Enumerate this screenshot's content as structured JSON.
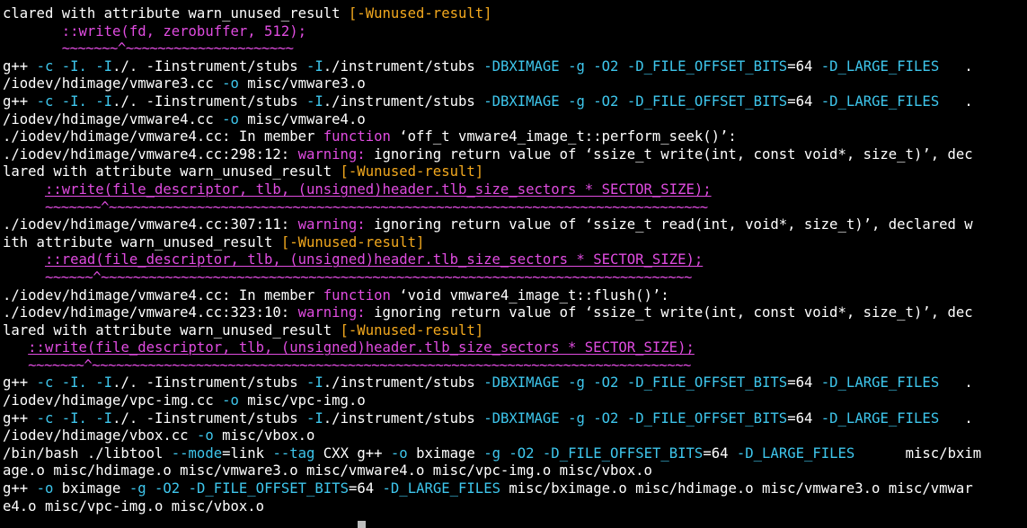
{
  "colors": {
    "background": "#000000",
    "text": "#ffffff",
    "option_flag": "#3ec6ec",
    "warning_keyword": "#e04ce0",
    "warning_option": "#f2a81e",
    "caret_marker": "#e04ce0",
    "cursor": "#bdbdbd"
  },
  "terminal": {
    "lines": [
      [
        {
          "c": "w",
          "t": "clared with attribute warn_unused_result "
        },
        {
          "c": "y",
          "t": "[-Wunused-result]"
        }
      ],
      [
        {
          "c": "w",
          "t": "       "
        },
        {
          "c": "m",
          "t": "::write(fd, zerobuffer, 512);"
        }
      ],
      [
        {
          "c": "w",
          "t": "       "
        },
        {
          "c": "sq",
          "t": "~~~~~~~^~~~~~~~~~~~~~~~~~~~~~"
        }
      ],
      [
        {
          "c": "w",
          "t": "g++ "
        },
        {
          "c": "c",
          "t": "-c"
        },
        {
          "c": "w",
          "t": " "
        },
        {
          "c": "c",
          "t": "-I."
        },
        {
          "c": "w",
          "t": " "
        },
        {
          "c": "c",
          "t": "-I"
        },
        {
          "c": "w",
          "t": "./. -Iinstrument/stubs "
        },
        {
          "c": "c",
          "t": "-I"
        },
        {
          "c": "w",
          "t": "./instrument/stubs "
        },
        {
          "c": "c",
          "t": "-DBXIMAGE"
        },
        {
          "c": "w",
          "t": " "
        },
        {
          "c": "c",
          "t": "-g"
        },
        {
          "c": "w",
          "t": " "
        },
        {
          "c": "c",
          "t": "-O2"
        },
        {
          "c": "w",
          "t": " "
        },
        {
          "c": "c",
          "t": "-D_FILE_OFFSET_BITS"
        },
        {
          "c": "w",
          "t": "=64 "
        },
        {
          "c": "c",
          "t": "-D_LARGE_FILES"
        },
        {
          "c": "w",
          "t": "   ."
        }
      ],
      [
        {
          "c": "w",
          "t": "/iodev/hdimage/vmware3.cc "
        },
        {
          "c": "c",
          "t": "-o"
        },
        {
          "c": "w",
          "t": " misc/vmware3.o"
        }
      ],
      [
        {
          "c": "w",
          "t": "g++ "
        },
        {
          "c": "c",
          "t": "-c"
        },
        {
          "c": "w",
          "t": " "
        },
        {
          "c": "c",
          "t": "-I."
        },
        {
          "c": "w",
          "t": " "
        },
        {
          "c": "c",
          "t": "-I"
        },
        {
          "c": "w",
          "t": "./. -Iinstrument/stubs "
        },
        {
          "c": "c",
          "t": "-I"
        },
        {
          "c": "w",
          "t": "./instrument/stubs "
        },
        {
          "c": "c",
          "t": "-DBXIMAGE"
        },
        {
          "c": "w",
          "t": " "
        },
        {
          "c": "c",
          "t": "-g"
        },
        {
          "c": "w",
          "t": " "
        },
        {
          "c": "c",
          "t": "-O2"
        },
        {
          "c": "w",
          "t": " "
        },
        {
          "c": "c",
          "t": "-D_FILE_OFFSET_BITS"
        },
        {
          "c": "w",
          "t": "=64 "
        },
        {
          "c": "c",
          "t": "-D_LARGE_FILES"
        },
        {
          "c": "w",
          "t": "   ."
        }
      ],
      [
        {
          "c": "w",
          "t": "/iodev/hdimage/vmware4.cc "
        },
        {
          "c": "c",
          "t": "-o"
        },
        {
          "c": "w",
          "t": " misc/vmware4.o"
        }
      ],
      [
        {
          "c": "w",
          "t": "./iodev/hdimage/vmware4.cc: In member "
        },
        {
          "c": "m",
          "t": "function"
        },
        {
          "c": "w",
          "t": " ‘off_t vmware4_image_t::perform_seek()’:"
        }
      ],
      [
        {
          "c": "w",
          "t": "./iodev/hdimage/vmware4.cc:298:12: "
        },
        {
          "c": "m",
          "t": "warning:"
        },
        {
          "c": "w",
          "t": " ignoring return value of ‘ssize_t write(int, const void*, size_t)’, dec"
        }
      ],
      [
        {
          "c": "w",
          "t": "lared with attribute warn_unused_result "
        },
        {
          "c": "y",
          "t": "[-Wunused-result]"
        }
      ],
      [
        {
          "c": "w",
          "t": "     "
        },
        {
          "c": "m-u",
          "t": "::write(file_descriptor, tlb, (unsigned)header.tlb_size_sectors * SECTOR_SIZE);"
        }
      ],
      [
        {
          "c": "w",
          "t": "     "
        },
        {
          "c": "sq",
          "t": "~~~~~~~^~~~~~~~~~~~~~~~~~~~~~~~~~~~~~~~~~~~~~~~~~~~~~~~~~~~~~~~~~~~~~~~~~~~~~~~~~~~"
        }
      ],
      [
        {
          "c": "w",
          "t": "./iodev/hdimage/vmware4.cc:307:11: "
        },
        {
          "c": "m",
          "t": "warning:"
        },
        {
          "c": "w",
          "t": " ignoring return value of ‘ssize_t read(int, void*, size_t)’, declared w"
        }
      ],
      [
        {
          "c": "w",
          "t": "ith attribute warn_unused_result "
        },
        {
          "c": "y",
          "t": "[-Wunused-result]"
        }
      ],
      [
        {
          "c": "w",
          "t": "     "
        },
        {
          "c": "m-u",
          "t": "::read(file_descriptor, tlb, (unsigned)header.tlb_size_sectors * SECTOR_SIZE);"
        }
      ],
      [
        {
          "c": "w",
          "t": "     "
        },
        {
          "c": "sq",
          "t": "~~~~~~^~~~~~~~~~~~~~~~~~~~~~~~~~~~~~~~~~~~~~~~~~~~~~~~~~~~~~~~~~~~~~~~~~~~~~~~~~~"
        }
      ],
      [
        {
          "c": "w",
          "t": "./iodev/hdimage/vmware4.cc: In member "
        },
        {
          "c": "m",
          "t": "function"
        },
        {
          "c": "w",
          "t": " ‘void vmware4_image_t::flush()’:"
        }
      ],
      [
        {
          "c": "w",
          "t": "./iodev/hdimage/vmware4.cc:323:10: "
        },
        {
          "c": "m",
          "t": "warning:"
        },
        {
          "c": "w",
          "t": " ignoring return value of ‘ssize_t write(int, const void*, size_t)’, dec"
        }
      ],
      [
        {
          "c": "w",
          "t": "lared with attribute warn_unused_result "
        },
        {
          "c": "y",
          "t": "[-Wunused-result]"
        }
      ],
      [
        {
          "c": "w",
          "t": "   "
        },
        {
          "c": "m-u",
          "t": "::write(file_descriptor, tlb, (unsigned)header.tlb_size_sectors * SECTOR_SIZE);"
        }
      ],
      [
        {
          "c": "w",
          "t": "   "
        },
        {
          "c": "sq",
          "t": "~~~~~~~^~~~~~~~~~~~~~~~~~~~~~~~~~~~~~~~~~~~~~~~~~~~~~~~~~~~~~~~~~~~~~~~~~~~~~~~~~~~"
        }
      ],
      [
        {
          "c": "w",
          "t": "g++ "
        },
        {
          "c": "c",
          "t": "-c"
        },
        {
          "c": "w",
          "t": " "
        },
        {
          "c": "c",
          "t": "-I."
        },
        {
          "c": "w",
          "t": " "
        },
        {
          "c": "c",
          "t": "-I"
        },
        {
          "c": "w",
          "t": "./. -Iinstrument/stubs "
        },
        {
          "c": "c",
          "t": "-I"
        },
        {
          "c": "w",
          "t": "./instrument/stubs "
        },
        {
          "c": "c",
          "t": "-DBXIMAGE"
        },
        {
          "c": "w",
          "t": " "
        },
        {
          "c": "c",
          "t": "-g"
        },
        {
          "c": "w",
          "t": " "
        },
        {
          "c": "c",
          "t": "-O2"
        },
        {
          "c": "w",
          "t": " "
        },
        {
          "c": "c",
          "t": "-D_FILE_OFFSET_BITS"
        },
        {
          "c": "w",
          "t": "=64 "
        },
        {
          "c": "c",
          "t": "-D_LARGE_FILES"
        },
        {
          "c": "w",
          "t": "   ."
        }
      ],
      [
        {
          "c": "w",
          "t": "/iodev/hdimage/vpc-img.cc "
        },
        {
          "c": "c",
          "t": "-o"
        },
        {
          "c": "w",
          "t": " misc/vpc-img.o"
        }
      ],
      [
        {
          "c": "w",
          "t": "g++ "
        },
        {
          "c": "c",
          "t": "-c"
        },
        {
          "c": "w",
          "t": " "
        },
        {
          "c": "c",
          "t": "-I."
        },
        {
          "c": "w",
          "t": " "
        },
        {
          "c": "c",
          "t": "-I"
        },
        {
          "c": "w",
          "t": "./. -Iinstrument/stubs "
        },
        {
          "c": "c",
          "t": "-I"
        },
        {
          "c": "w",
          "t": "./instrument/stubs "
        },
        {
          "c": "c",
          "t": "-DBXIMAGE"
        },
        {
          "c": "w",
          "t": " "
        },
        {
          "c": "c",
          "t": "-g"
        },
        {
          "c": "w",
          "t": " "
        },
        {
          "c": "c",
          "t": "-O2"
        },
        {
          "c": "w",
          "t": " "
        },
        {
          "c": "c",
          "t": "-D_FILE_OFFSET_BITS"
        },
        {
          "c": "w",
          "t": "=64 "
        },
        {
          "c": "c",
          "t": "-D_LARGE_FILES"
        },
        {
          "c": "w",
          "t": "   ."
        }
      ],
      [
        {
          "c": "w",
          "t": "/iodev/hdimage/vbox.cc "
        },
        {
          "c": "c",
          "t": "-o"
        },
        {
          "c": "w",
          "t": " misc/vbox.o"
        }
      ],
      [
        {
          "c": "w",
          "t": "/bin/bash ./libtool "
        },
        {
          "c": "c",
          "t": "--mode"
        },
        {
          "c": "w",
          "t": "=link "
        },
        {
          "c": "c",
          "t": "--tag"
        },
        {
          "c": "w",
          "t": " CXX g++ "
        },
        {
          "c": "c",
          "t": "-o"
        },
        {
          "c": "w",
          "t": " bximage "
        },
        {
          "c": "c",
          "t": "-g"
        },
        {
          "c": "w",
          "t": " "
        },
        {
          "c": "c",
          "t": "-O2"
        },
        {
          "c": "w",
          "t": " "
        },
        {
          "c": "c",
          "t": "-D_FILE_OFFSET_BITS"
        },
        {
          "c": "w",
          "t": "=64 "
        },
        {
          "c": "c",
          "t": "-D_LARGE_FILES"
        },
        {
          "c": "w",
          "t": "      misc/bxim"
        }
      ],
      [
        {
          "c": "w",
          "t": "age.o misc/hdimage.o misc/vmware3.o misc/vmware4.o misc/vpc-img.o misc/vbox.o"
        }
      ],
      [
        {
          "c": "w",
          "t": "g++ "
        },
        {
          "c": "c",
          "t": "-o"
        },
        {
          "c": "w",
          "t": " bximage "
        },
        {
          "c": "c",
          "t": "-g"
        },
        {
          "c": "w",
          "t": " "
        },
        {
          "c": "c",
          "t": "-O2"
        },
        {
          "c": "w",
          "t": " "
        },
        {
          "c": "c",
          "t": "-D_FILE_OFFSET_BITS"
        },
        {
          "c": "w",
          "t": "=64 "
        },
        {
          "c": "c",
          "t": "-D_LARGE_FILES"
        },
        {
          "c": "w",
          "t": " misc/bximage.o misc/hdimage.o misc/vmware3.o misc/vmwar"
        }
      ],
      [
        {
          "c": "w",
          "t": "e4.o misc/vpc-img.o misc/vbox.o"
        }
      ]
    ]
  }
}
